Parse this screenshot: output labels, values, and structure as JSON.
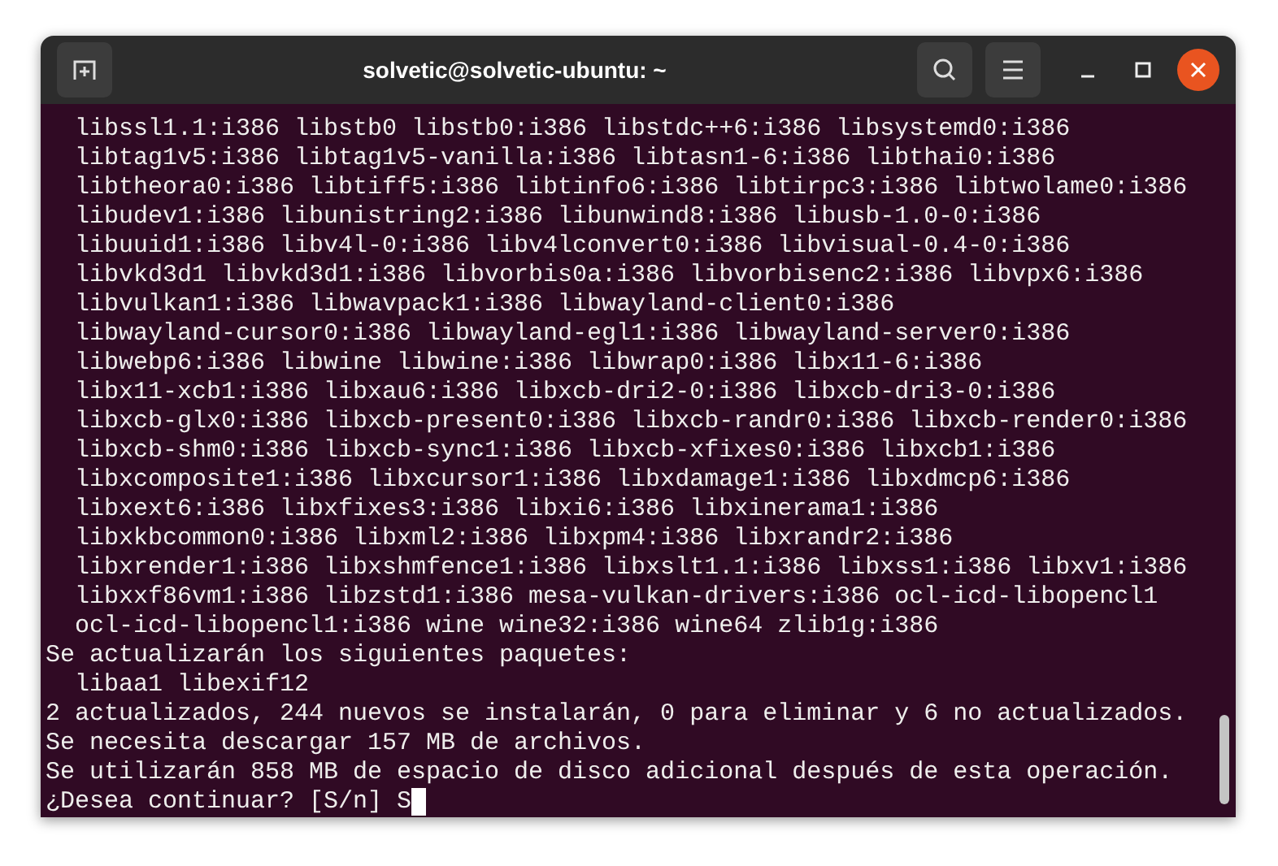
{
  "window": {
    "title": "solvetic@solvetic-ubuntu: ~"
  },
  "terminal": {
    "lines": [
      "  libssl1.1:i386 libstb0 libstb0:i386 libstdc++6:i386 libsystemd0:i386",
      "  libtag1v5:i386 libtag1v5-vanilla:i386 libtasn1-6:i386 libthai0:i386",
      "  libtheora0:i386 libtiff5:i386 libtinfo6:i386 libtirpc3:i386 libtwolame0:i386",
      "  libudev1:i386 libunistring2:i386 libunwind8:i386 libusb-1.0-0:i386",
      "  libuuid1:i386 libv4l-0:i386 libv4lconvert0:i386 libvisual-0.4-0:i386",
      "  libvkd3d1 libvkd3d1:i386 libvorbis0a:i386 libvorbisenc2:i386 libvpx6:i386",
      "  libvulkan1:i386 libwavpack1:i386 libwayland-client0:i386",
      "  libwayland-cursor0:i386 libwayland-egl1:i386 libwayland-server0:i386",
      "  libwebp6:i386 libwine libwine:i386 libwrap0:i386 libx11-6:i386",
      "  libx11-xcb1:i386 libxau6:i386 libxcb-dri2-0:i386 libxcb-dri3-0:i386",
      "  libxcb-glx0:i386 libxcb-present0:i386 libxcb-randr0:i386 libxcb-render0:i386",
      "  libxcb-shm0:i386 libxcb-sync1:i386 libxcb-xfixes0:i386 libxcb1:i386",
      "  libxcomposite1:i386 libxcursor1:i386 libxdamage1:i386 libxdmcp6:i386",
      "  libxext6:i386 libxfixes3:i386 libxi6:i386 libxinerama1:i386",
      "  libxkbcommon0:i386 libxml2:i386 libxpm4:i386 libxrandr2:i386",
      "  libxrender1:i386 libxshmfence1:i386 libxslt1.1:i386 libxss1:i386 libxv1:i386",
      "  libxxf86vm1:i386 libzstd1:i386 mesa-vulkan-drivers:i386 ocl-icd-libopencl1",
      "  ocl-icd-libopencl1:i386 wine wine32:i386 wine64 zlib1g:i386",
      "Se actualizarán los siguientes paquetes:",
      "  libaa1 libexif12",
      "2 actualizados, 244 nuevos se instalarán, 0 para eliminar y 6 no actualizados.",
      "Se necesita descargar 157 MB de archivos.",
      "Se utilizarán 858 MB de espacio de disco adicional después de esta operación.",
      "¿Desea continuar? [S/n] S"
    ]
  }
}
